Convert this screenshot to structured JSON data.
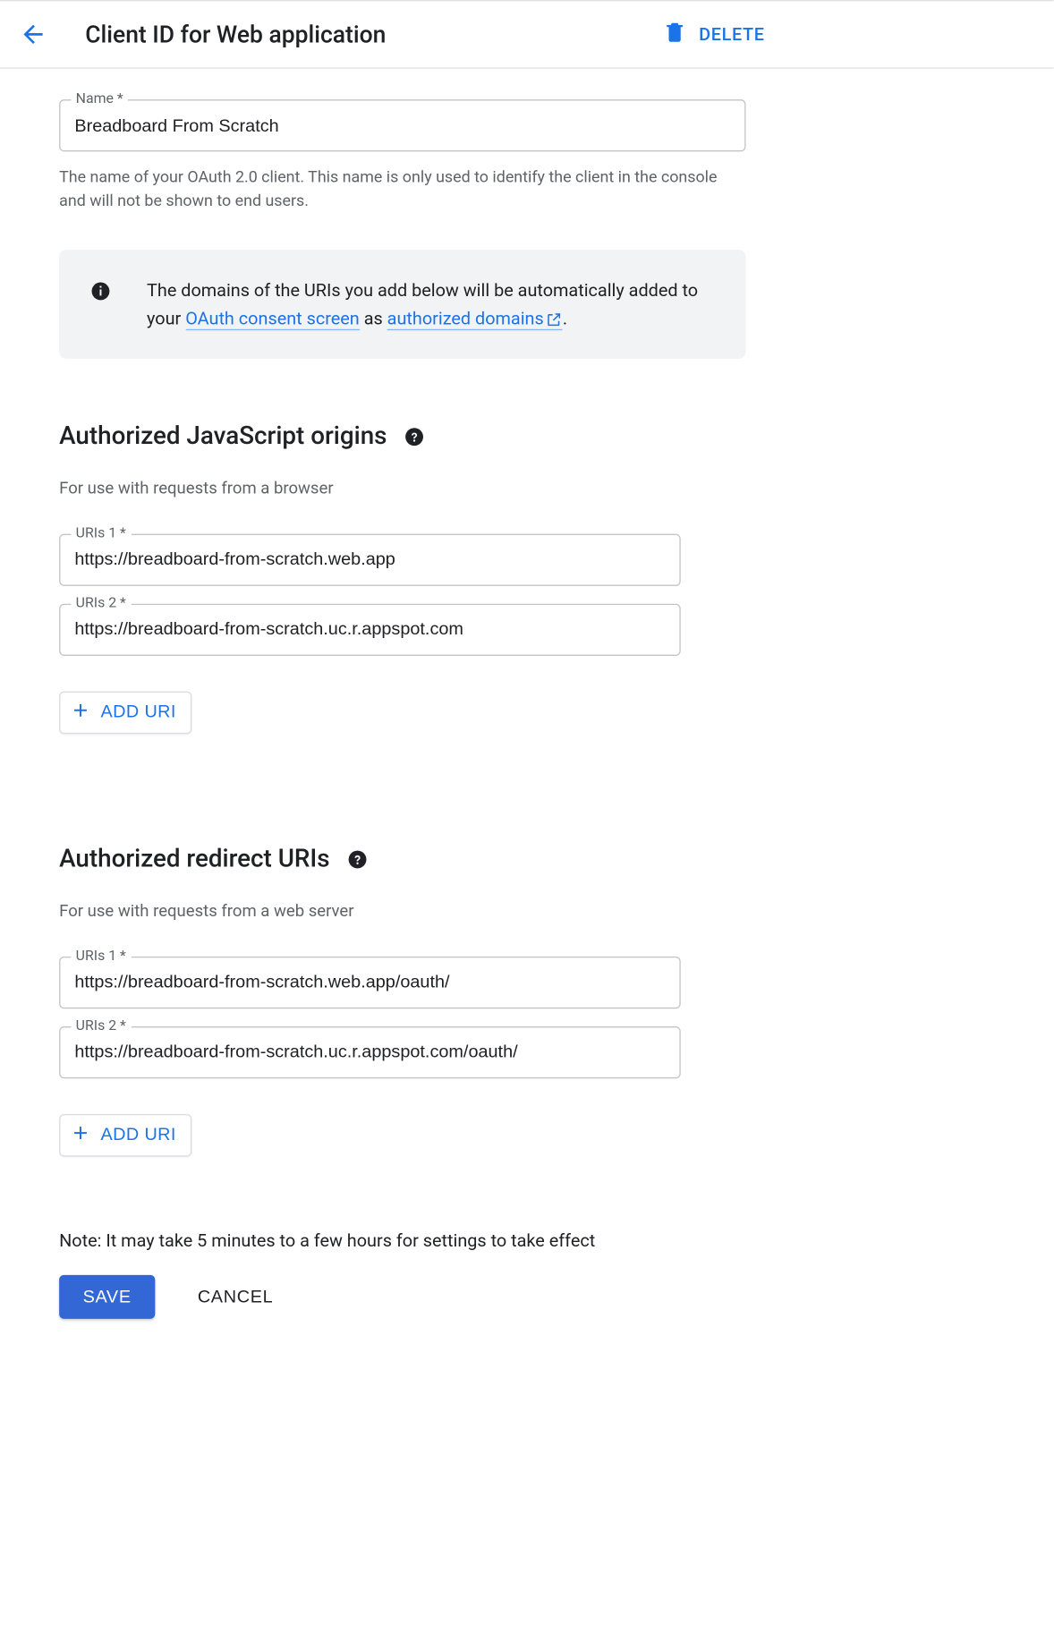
{
  "header": {
    "title": "Client ID for Web application",
    "delete_label": "DELETE"
  },
  "name_field": {
    "label": "Name *",
    "value": "Breadboard From Scratch",
    "help": "The name of your OAuth 2.0 client. This name is only used to identify the client in the console and will not be shown to end users."
  },
  "info_box": {
    "text_prefix": "The domains of the URIs you add below will be automatically added to your ",
    "link1": "OAuth consent screen",
    "text_mid": " as ",
    "link2": "authorized domains",
    "text_suffix": "."
  },
  "js_origins": {
    "title": "Authorized JavaScript origins",
    "subtitle": "For use with requests from a browser",
    "items": [
      {
        "label": "URIs 1 *",
        "value": "https://breadboard-from-scratch.web.app"
      },
      {
        "label": "URIs 2 *",
        "value": "https://breadboard-from-scratch.uc.r.appspot.com"
      }
    ],
    "add_label": "ADD URI"
  },
  "redirect_uris": {
    "title": "Authorized redirect URIs",
    "subtitle": "For use with requests from a web server",
    "items": [
      {
        "label": "URIs 1 *",
        "value": "https://breadboard-from-scratch.web.app/oauth/"
      },
      {
        "label": "URIs 2 *",
        "value": "https://breadboard-from-scratch.uc.r.appspot.com/oauth/"
      }
    ],
    "add_label": "ADD URI"
  },
  "note": "Note: It may take 5 minutes to a few hours for settings to take effect",
  "actions": {
    "save": "SAVE",
    "cancel": "CANCEL"
  }
}
